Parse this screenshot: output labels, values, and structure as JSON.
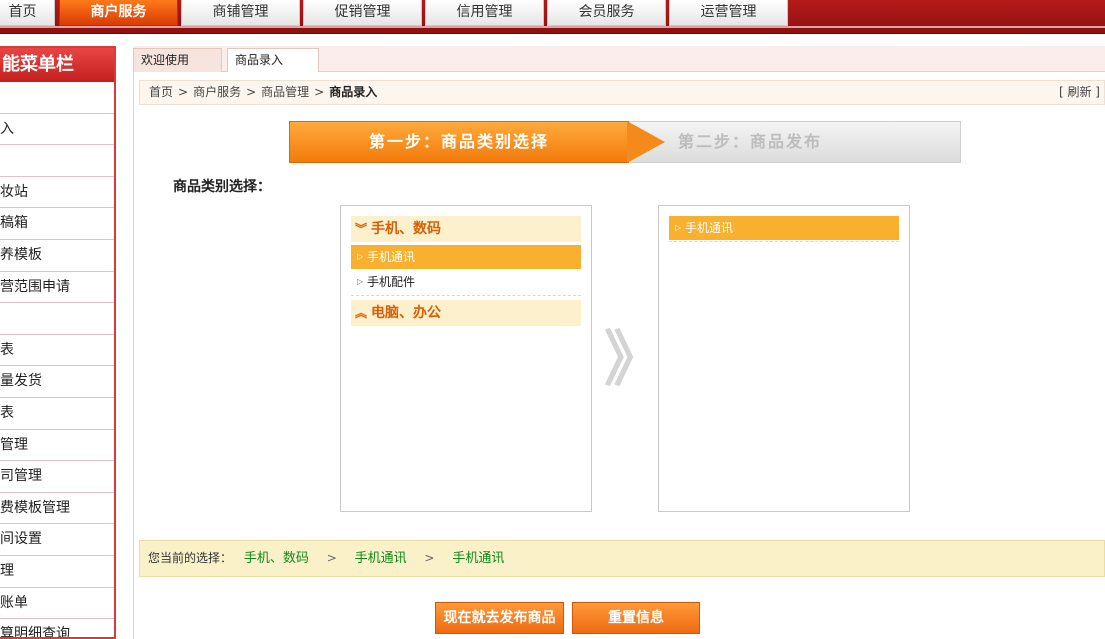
{
  "nav": {
    "tabs": [
      {
        "label": "首页"
      },
      {
        "label": "商户服务"
      },
      {
        "label": "商铺管理"
      },
      {
        "label": "促销管理"
      },
      {
        "label": "信用管理"
      },
      {
        "label": "会员服务"
      },
      {
        "label": "运营管理"
      }
    ]
  },
  "sidebar": {
    "title": "能菜单栏",
    "items": [
      "",
      "入",
      "",
      "妆站",
      "稿箱",
      "养模板",
      "营范围申请",
      "",
      "表",
      "量发货",
      "表",
      "管理",
      "司管理",
      "费模板管理",
      "间设置",
      "理",
      "账单",
      "算明细查询"
    ]
  },
  "content_tabs": [
    {
      "label": "欢迎使用"
    },
    {
      "label": "商品录入"
    }
  ],
  "breadcrumb": {
    "items": [
      "首页",
      "商户服务",
      "商品管理"
    ],
    "current": "商品录入",
    "refresh": "[ 刷新 ]"
  },
  "steps": {
    "step1": "第一步：商品类别选择",
    "step2": "第二步：商品发布"
  },
  "category_label": "商品类别选择：",
  "left_panel": {
    "groups": [
      {
        "label": "手机、数码",
        "chevron": "»",
        "items": [
          "手机通讯",
          "手机配件"
        ]
      },
      {
        "label": "电脑、办公",
        "chevron": "«"
      }
    ]
  },
  "right_panel": {
    "items": [
      "手机通讯"
    ]
  },
  "arrow_glyph": "》",
  "selection": {
    "label": "您当前的选择：",
    "path": [
      "手机、数码",
      "手机通讯",
      "手机通讯"
    ],
    "separator": ">"
  },
  "buttons": {
    "publish": "现在就去发布商品",
    "reset": "重置信息"
  }
}
